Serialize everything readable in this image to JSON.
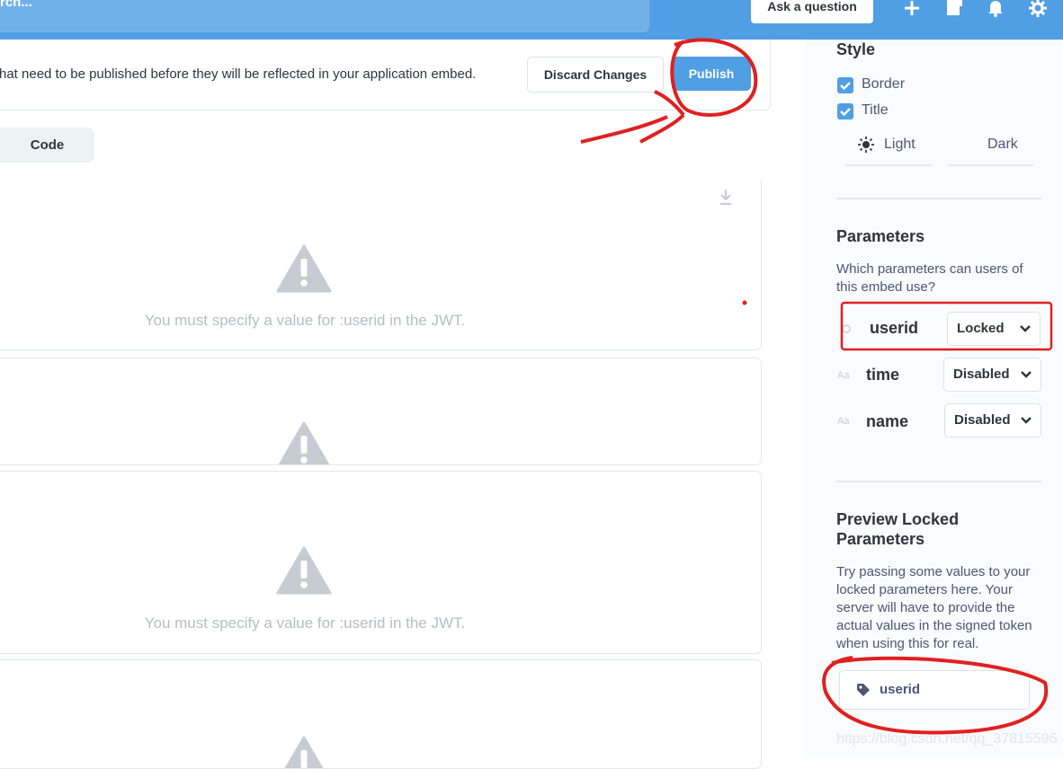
{
  "header": {
    "search_placeholder": "rch...",
    "ask_label": "Ask a question"
  },
  "banner": {
    "text": "hat need to be published before they will be reflected in your application embed.",
    "discard_label": "Discard Changes",
    "publish_label": "Publish"
  },
  "tabs": {
    "code_label": "Code"
  },
  "cards": [
    {
      "message": "You must specify a value for :userid in the JWT."
    },
    {
      "message": ""
    },
    {
      "message": "You must specify a value for :userid in the JWT."
    },
    {
      "message": ""
    }
  ],
  "sidebar": {
    "style_heading": "Style",
    "border_label": "Border",
    "title_label": "Title",
    "light_label": "Light",
    "dark_label": "Dark",
    "parameters_heading": "Parameters",
    "parameters_desc": "Which parameters can users of this embed use?",
    "params": [
      {
        "name": "userid",
        "mode": "Locked"
      },
      {
        "name": "time",
        "mode": "Disabled",
        "type_icon": "Aa"
      },
      {
        "name": "name",
        "mode": "Disabled",
        "type_icon": "Aa"
      }
    ],
    "preview_heading": "Preview Locked Parameters",
    "preview_desc": "Try passing some values to your locked parameters here. Your server will have to provide the actual values in the signed token when using this for real.",
    "preview_input_label": "userid",
    "watermark": "https://blog.csdn.net/qq_37815596"
  },
  "colors": {
    "brand": "#509ee3",
    "annotation_red": "#e02020"
  }
}
